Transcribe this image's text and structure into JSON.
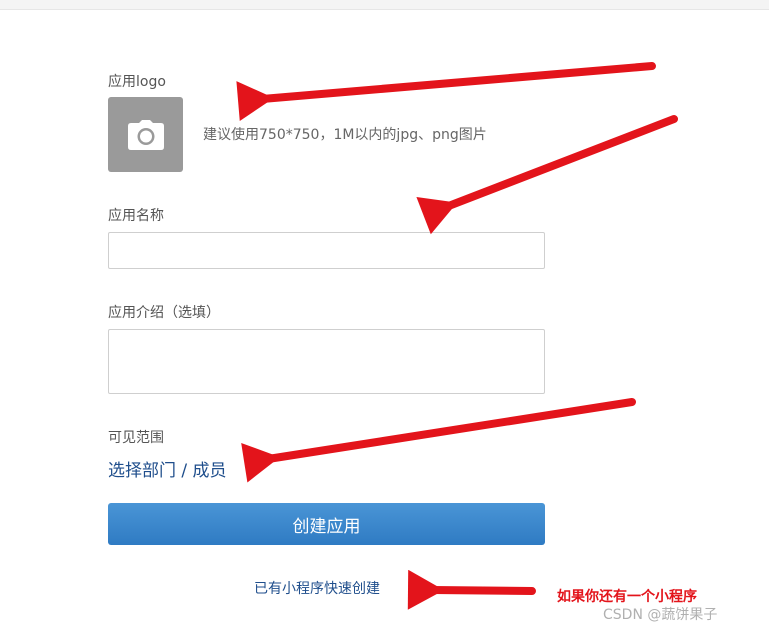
{
  "form": {
    "logo_label": "应用logo",
    "logo_hint": "建议使用750*750，1M以内的jpg、png图片",
    "name_label": "应用名称",
    "name_value": "",
    "intro_label": "应用介绍（选填）",
    "intro_value": "",
    "scope_label": "可见范围",
    "scope_link": "选择部门 / 成员",
    "create_button": "创建应用",
    "quick_create_link": "已有小程序快速创建"
  },
  "annotation": {
    "note": "如果你还有一个小程序",
    "arrow_color": "#e3141b"
  },
  "watermark": {
    "text": "CSDN @蔬饼果子"
  },
  "colors": {
    "primary_button": "#3a87cc",
    "link": "#1f4e8c",
    "logo_placeholder": "#9a9a9a"
  },
  "icons": {
    "logo_upload": "camera-icon"
  }
}
